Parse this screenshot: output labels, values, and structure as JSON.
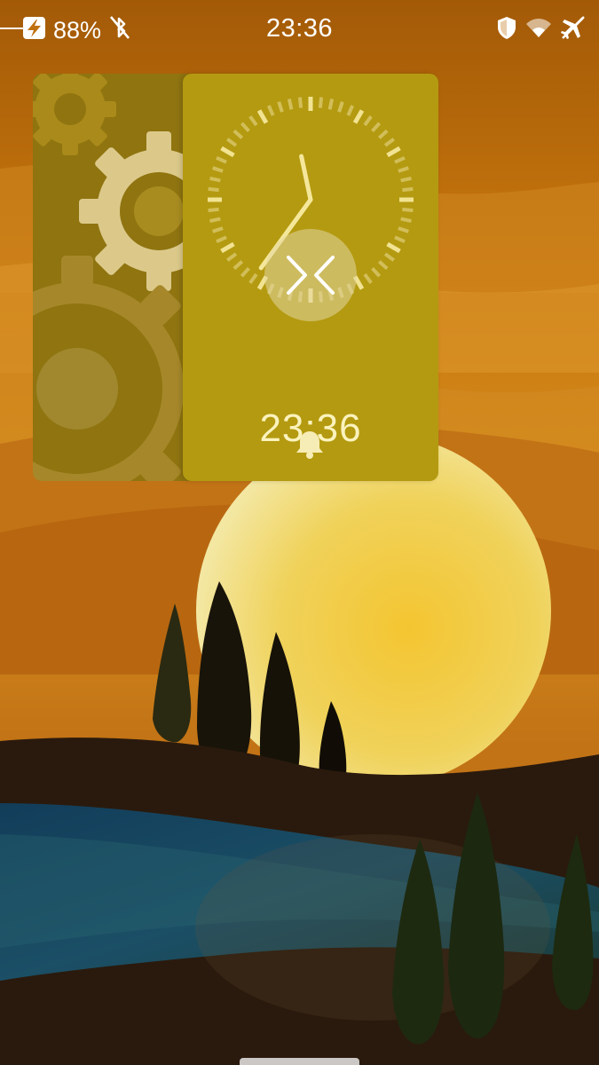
{
  "status_bar": {
    "battery_percent": "88%",
    "time": "23:36",
    "icons": [
      "charging-icon",
      "bluetooth-off-icon",
      "shield-icon",
      "wifi-icon",
      "airplane-mode-icon"
    ]
  },
  "covers": {
    "settings": {
      "icon": "gears-icon"
    },
    "clock": {
      "time": "23:36",
      "hour": 23,
      "minute": 36,
      "icon": "alarm-bell-icon",
      "center_icon": "pulley-menu-icon"
    }
  },
  "colors": {
    "sky_top": "#b86a0a",
    "clock_cover": "#b49a10",
    "settings_cover": "#8f7410",
    "sun": "#f2cf3c",
    "water": "#1d4b63",
    "ground": "#2a1a0d"
  }
}
